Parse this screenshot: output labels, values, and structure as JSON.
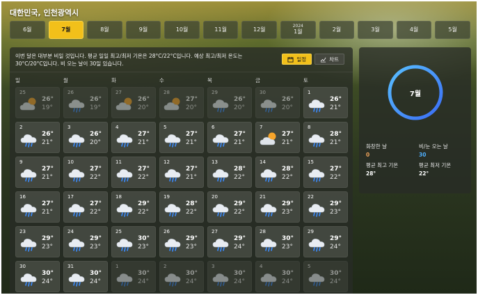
{
  "location": "대한민국, 인천광역시",
  "months": [
    {
      "label": "6월",
      "year": "",
      "active": false
    },
    {
      "label": "7월",
      "year": "",
      "active": true
    },
    {
      "label": "8월",
      "year": "",
      "active": false
    },
    {
      "label": "9월",
      "year": "",
      "active": false
    },
    {
      "label": "10월",
      "year": "",
      "active": false
    },
    {
      "label": "11월",
      "year": "",
      "active": false
    },
    {
      "label": "12월",
      "year": "",
      "active": false
    },
    {
      "label": "1월",
      "year": "2024",
      "active": false
    },
    {
      "label": "2월",
      "year": "",
      "active": false
    },
    {
      "label": "3월",
      "year": "",
      "active": false
    },
    {
      "label": "4월",
      "year": "",
      "active": false
    },
    {
      "label": "5월",
      "year": "",
      "active": false
    }
  ],
  "summary": "이번 달은 대부분 비일 것입니다. 평균 일일 최고/최저 기온은 28°C/22°C입니다. 예상 최고/최저 온도는 30°C/20°C입니다. 비 오는 날이 30일 있습니다.",
  "toggle": {
    "calendar_label": "일정",
    "chart_label": "차트"
  },
  "weekdays": [
    "일",
    "월",
    "화",
    "수",
    "목",
    "금",
    "토"
  ],
  "days": [
    {
      "day": "25",
      "icon": "partly-cloudy",
      "hi": "26°",
      "lo": "19°",
      "other": true
    },
    {
      "day": "26",
      "icon": "rain",
      "hi": "26°",
      "lo": "19°",
      "other": true
    },
    {
      "day": "27",
      "icon": "partly-cloudy",
      "hi": "26°",
      "lo": "20°",
      "other": true
    },
    {
      "day": "28",
      "icon": "partly-cloudy",
      "hi": "27°",
      "lo": "20°",
      "other": true
    },
    {
      "day": "29",
      "icon": "rain",
      "hi": "26°",
      "lo": "20°",
      "other": true
    },
    {
      "day": "30",
      "icon": "rain",
      "hi": "26°",
      "lo": "20°",
      "other": true
    },
    {
      "day": "1",
      "icon": "rain",
      "hi": "26°",
      "lo": "21°",
      "other": false
    },
    {
      "day": "2",
      "icon": "rain",
      "hi": "26°",
      "lo": "21°",
      "other": false
    },
    {
      "day": "3",
      "icon": "rain",
      "hi": "26°",
      "lo": "20°",
      "other": false
    },
    {
      "day": "4",
      "icon": "rain",
      "hi": "27°",
      "lo": "21°",
      "other": false
    },
    {
      "day": "5",
      "icon": "rain",
      "hi": "27°",
      "lo": "21°",
      "other": false
    },
    {
      "day": "6",
      "icon": "rain",
      "hi": "27°",
      "lo": "21°",
      "other": false
    },
    {
      "day": "7",
      "icon": "partly-cloudy",
      "hi": "27°",
      "lo": "21°",
      "other": false
    },
    {
      "day": "8",
      "icon": "rain",
      "hi": "28°",
      "lo": "21°",
      "other": false
    },
    {
      "day": "9",
      "icon": "rain",
      "hi": "27°",
      "lo": "21°",
      "other": false
    },
    {
      "day": "10",
      "icon": "rain",
      "hi": "27°",
      "lo": "22°",
      "other": false
    },
    {
      "day": "11",
      "icon": "rain",
      "hi": "27°",
      "lo": "22°",
      "other": false
    },
    {
      "day": "12",
      "icon": "rain",
      "hi": "27°",
      "lo": "21°",
      "other": false
    },
    {
      "day": "13",
      "icon": "rain",
      "hi": "28°",
      "lo": "22°",
      "other": false
    },
    {
      "day": "14",
      "icon": "rain",
      "hi": "28°",
      "lo": "22°",
      "other": false
    },
    {
      "day": "15",
      "icon": "rain",
      "hi": "27°",
      "lo": "22°",
      "other": false
    },
    {
      "day": "16",
      "icon": "rain",
      "hi": "27°",
      "lo": "21°",
      "other": false
    },
    {
      "day": "17",
      "icon": "rain",
      "hi": "27°",
      "lo": "22°",
      "other": false
    },
    {
      "day": "18",
      "icon": "rain",
      "hi": "29°",
      "lo": "22°",
      "other": false
    },
    {
      "day": "19",
      "icon": "rain",
      "hi": "28°",
      "lo": "22°",
      "other": false
    },
    {
      "day": "20",
      "icon": "rain",
      "hi": "29°",
      "lo": "22°",
      "other": false
    },
    {
      "day": "21",
      "icon": "rain",
      "hi": "29°",
      "lo": "23°",
      "other": false
    },
    {
      "day": "22",
      "icon": "rain",
      "hi": "29°",
      "lo": "23°",
      "other": false
    },
    {
      "day": "23",
      "icon": "rain",
      "hi": "29°",
      "lo": "23°",
      "other": false
    },
    {
      "day": "24",
      "icon": "rain",
      "hi": "29°",
      "lo": "23°",
      "other": false
    },
    {
      "day": "25",
      "icon": "rain",
      "hi": "30°",
      "lo": "23°",
      "other": false
    },
    {
      "day": "26",
      "icon": "rain",
      "hi": "29°",
      "lo": "23°",
      "other": false
    },
    {
      "day": "27",
      "icon": "rain",
      "hi": "29°",
      "lo": "24°",
      "other": false
    },
    {
      "day": "28",
      "icon": "rain",
      "hi": "30°",
      "lo": "23°",
      "other": false
    },
    {
      "day": "29",
      "icon": "rain",
      "hi": "29°",
      "lo": "24°",
      "other": false
    },
    {
      "day": "30",
      "icon": "rain",
      "hi": "30°",
      "lo": "24°",
      "other": false
    },
    {
      "day": "31",
      "icon": "rain",
      "hi": "30°",
      "lo": "24°",
      "other": false
    },
    {
      "day": "1",
      "icon": "rain",
      "hi": "30°",
      "lo": "24°",
      "other": true
    },
    {
      "day": "2",
      "icon": "rain",
      "hi": "30°",
      "lo": "24°",
      "other": true
    },
    {
      "day": "3",
      "icon": "rain",
      "hi": "30°",
      "lo": "24°",
      "other": true
    },
    {
      "day": "4",
      "icon": "rain",
      "hi": "30°",
      "lo": "24°",
      "other": true
    },
    {
      "day": "5",
      "icon": "rain",
      "hi": "30°",
      "lo": "24°",
      "other": true
    }
  ],
  "side": {
    "month": "7월",
    "clear_days_label": "화창한 날",
    "clear_days": "0",
    "rain_days_label": "비/눈 오는 날",
    "rain_days": "30",
    "avg_high_label": "평균 최고 기온",
    "avg_high": "28°",
    "avg_low_label": "평균 최저 기온",
    "avg_low": "22°"
  },
  "colors": {
    "accent": "#f2c01a",
    "clear_days_value": "#f0a35a",
    "rain_days_value": "#4fb0ff",
    "ring_start": "#59c0ff",
    "ring_end": "#3a6cf5"
  }
}
